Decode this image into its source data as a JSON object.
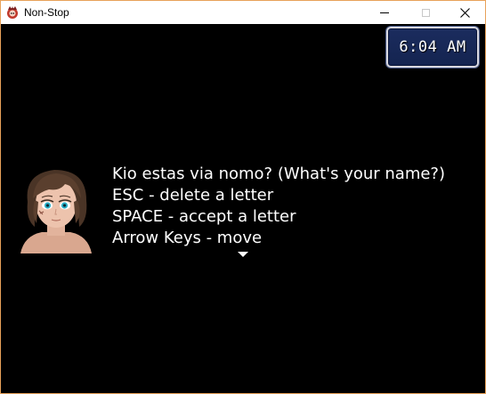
{
  "window": {
    "title": "Non-Stop",
    "app_icon": "rpg-maker-icon",
    "controls": {
      "minimize_icon": "minimize-icon",
      "maximize_icon": "maximize-icon",
      "close_icon": "close-icon",
      "close_glyph": "✕"
    }
  },
  "game": {
    "clock": "6:04 AM",
    "portrait": "character-face",
    "message_lines": [
      "Kio estas via nomo? (What's your name?)",
      "ESC - delete a letter",
      "SPACE - accept a letter",
      "Arrow Keys - move"
    ],
    "pause_indicator": "down-arrow-icon"
  },
  "colors": {
    "background": "#000000",
    "window_border": "#e8a25a",
    "clock_bg": "#1b2c5e",
    "text": "#ffffff"
  }
}
